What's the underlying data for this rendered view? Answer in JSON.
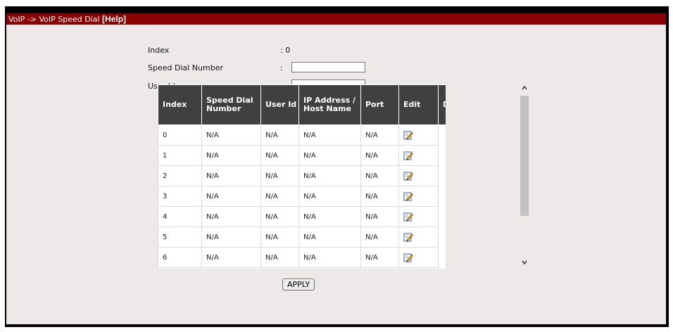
{
  "header": {
    "path": "VoIP -> VoIP Speed Dial",
    "help": "[Help]"
  },
  "form": {
    "index_label": "Index",
    "index_sep": ": 0",
    "speed_dial_label": "Speed Dial Number",
    "speed_dial_sep": ":",
    "speed_dial_value": "",
    "user_id_label": "User Id",
    "user_id_sep": ":",
    "user_id_value": ""
  },
  "table": {
    "headers": {
      "index": "Index",
      "speed": "Speed Dial Number",
      "user": "User Id",
      "ip": "IP Address / Host Name",
      "port": "Port",
      "edit": "Edit",
      "drop": "Drop"
    },
    "rows": [
      {
        "index": "0",
        "speed": "N/A",
        "user": "N/A",
        "ip": "N/A",
        "port": "N/A"
      },
      {
        "index": "1",
        "speed": "N/A",
        "user": "N/A",
        "ip": "N/A",
        "port": "N/A"
      },
      {
        "index": "2",
        "speed": "N/A",
        "user": "N/A",
        "ip": "N/A",
        "port": "N/A"
      },
      {
        "index": "3",
        "speed": "N/A",
        "user": "N/A",
        "ip": "N/A",
        "port": "N/A"
      },
      {
        "index": "4",
        "speed": "N/A",
        "user": "N/A",
        "ip": "N/A",
        "port": "N/A"
      },
      {
        "index": "5",
        "speed": "N/A",
        "user": "N/A",
        "ip": "N/A",
        "port": "N/A"
      },
      {
        "index": "6",
        "speed": "N/A",
        "user": "N/A",
        "ip": "N/A",
        "port": "N/A"
      }
    ],
    "edit_icon": "edit-pencil-icon"
  },
  "scrollbar": {
    "up": "^",
    "down": "v"
  },
  "apply_label": "APPLY",
  "colors": {
    "titlebar": "#8b0000",
    "header_bg": "#404040",
    "content_bg": "#ede9e9"
  }
}
